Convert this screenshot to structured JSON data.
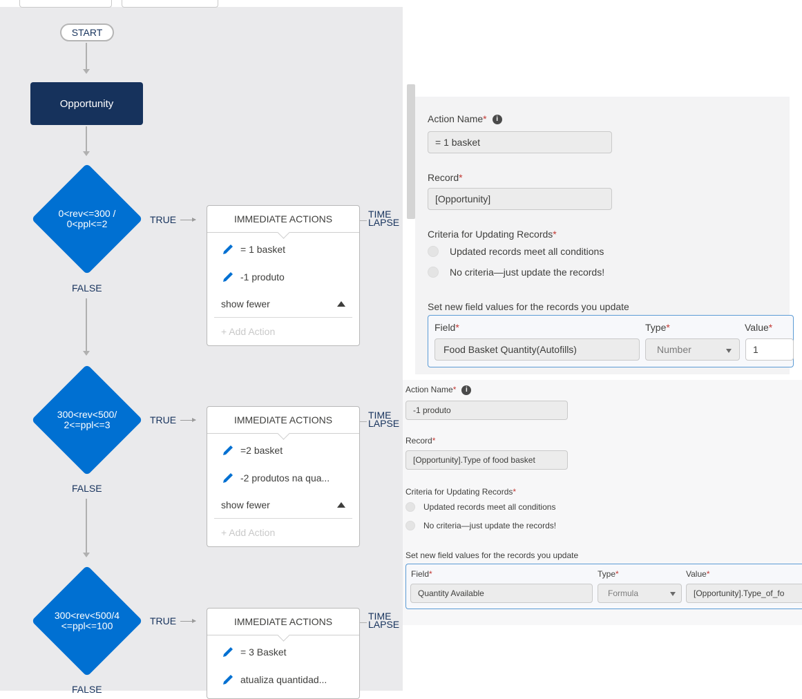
{
  "flow": {
    "start_label": "START",
    "object_label": "Opportunity",
    "true_label": "TRUE",
    "false_label": "FALSE",
    "time_lapse_label_1": "TIME",
    "time_lapse_label_2": "LAPSE",
    "immediate_actions_label": "IMMEDIATE ACTIONS",
    "show_fewer_label": "show fewer",
    "add_action_label": "+ Add Action",
    "criteria": [
      {
        "line1": "0<rev<=300 /",
        "line2": "0<ppl<=2",
        "actions": [
          "= 1 basket",
          "-1 produto"
        ]
      },
      {
        "line1": "300<rev<500/",
        "line2": "2<=ppl<=3",
        "actions": [
          "=2 basket",
          "-2 produtos na qua..."
        ]
      },
      {
        "line1": "300<rev<500/4",
        "line2": "<=ppl<=100",
        "actions": [
          "= 3 Basket",
          "atualiza quantidad..."
        ]
      }
    ]
  },
  "panel1": {
    "action_name_label": "Action Name",
    "action_name_value": "= 1 basket",
    "record_label": "Record",
    "record_value": "[Opportunity]",
    "criteria_label": "Criteria for Updating Records",
    "criteria_option_1": "Updated records meet all conditions",
    "criteria_option_2": "No criteria—just update the records!",
    "set_values_label": "Set new field values for the records you update",
    "col_field": "Field",
    "col_type": "Type",
    "col_value": "Value",
    "row_field": "Food Basket Quantity(Autofills)",
    "row_type": "Number",
    "row_value": "1"
  },
  "panel2": {
    "action_name_label": "Action Name",
    "action_name_value": "-1 produto",
    "record_label": "Record",
    "record_value": "[Opportunity].Type of food basket",
    "criteria_label": "Criteria for Updating Records",
    "criteria_option_1": "Updated records meet all conditions",
    "criteria_option_2": "No criteria—just update the records!",
    "set_values_label": "Set new field values for the records you update",
    "col_field": "Field",
    "col_type": "Type",
    "col_value": "Value",
    "row_field": "Quantity Available",
    "row_type": "Formula",
    "row_value": "[Opportunity].Type_of_fo"
  },
  "colors": {
    "canvas": "#eaeaec",
    "object_node": "#16325c",
    "criteria_node": "#0070d2",
    "required": "#c23934"
  }
}
